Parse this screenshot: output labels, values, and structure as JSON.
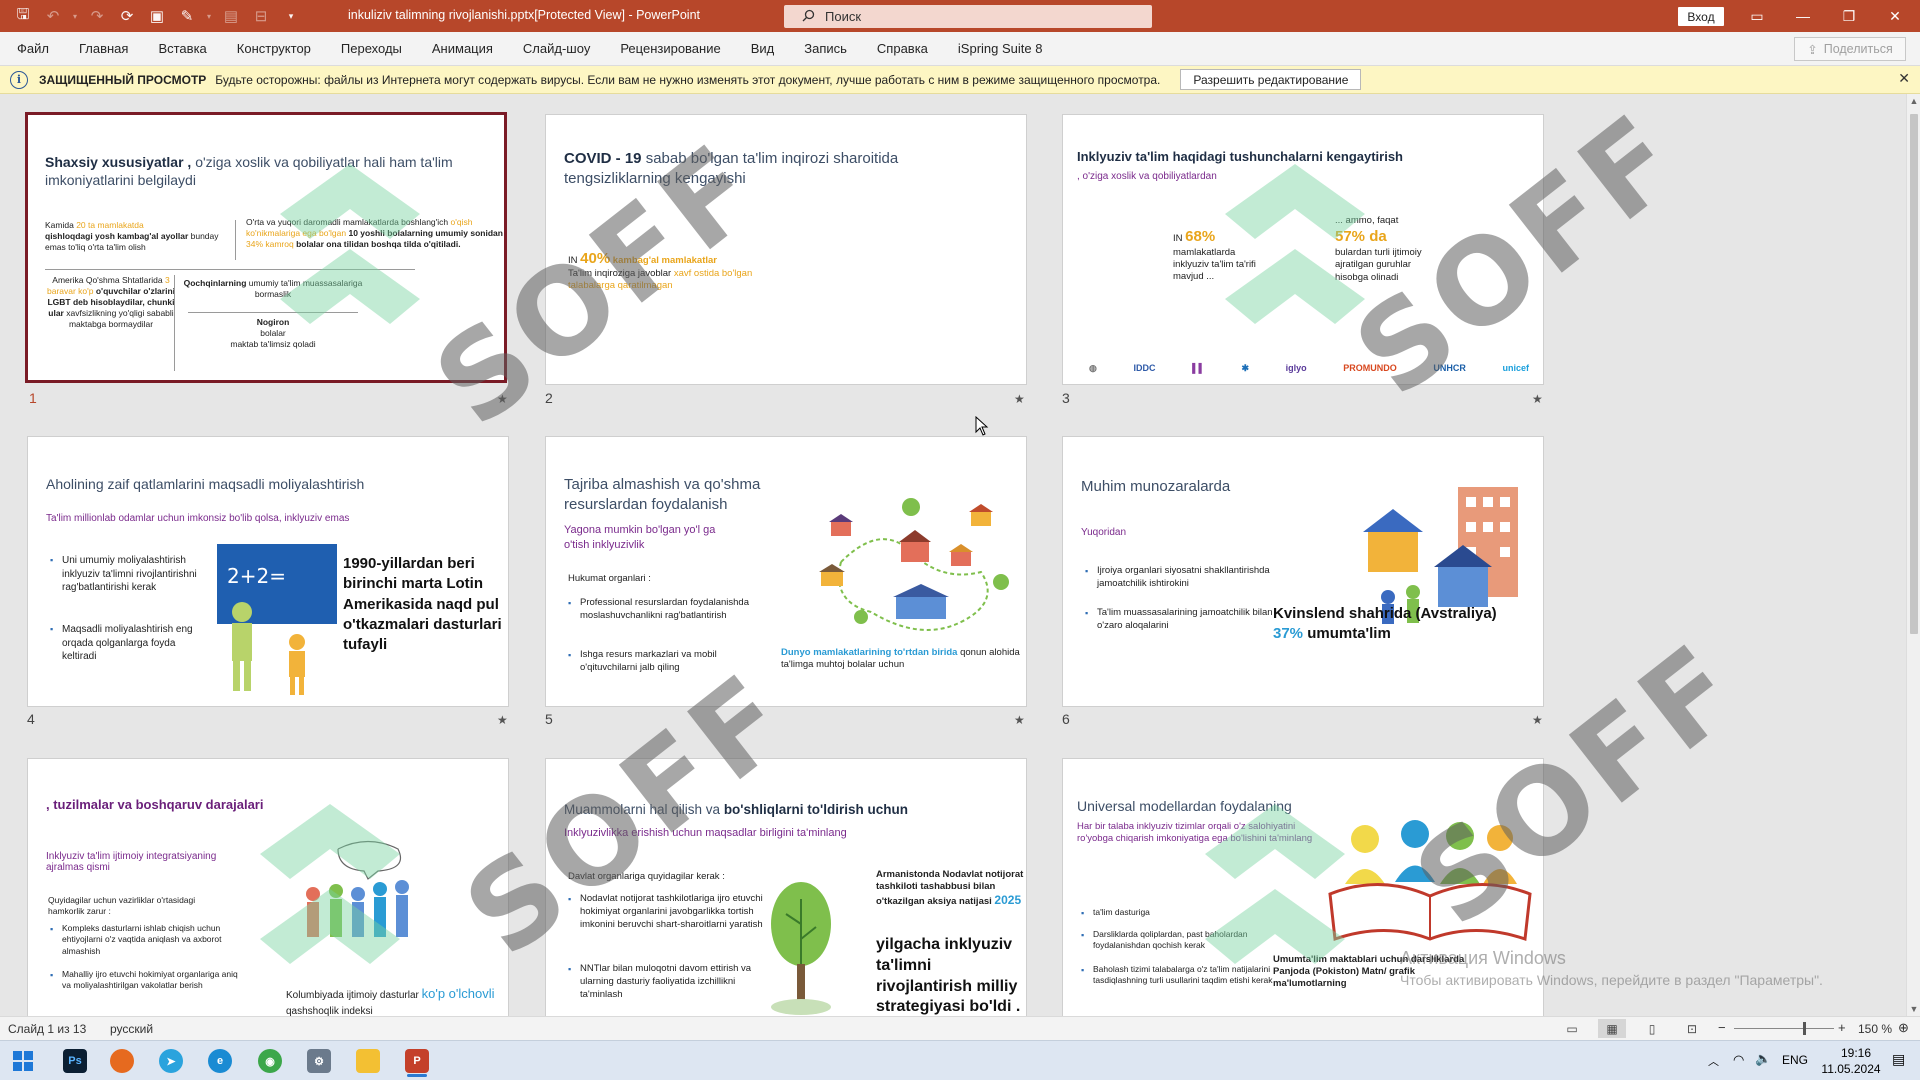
{
  "titlebar": {
    "doc_title": "inkuliziv talimning rivojlanishi.pptx[Protected View]  -  PowerPoint",
    "search_placeholder": "Поиск",
    "login": "Вход"
  },
  "menu": [
    "Файл",
    "Главная",
    "Вставка",
    "Конструктор",
    "Переходы",
    "Анимация",
    "Слайд-шоу",
    "Рецензирование",
    "Вид",
    "Запись",
    "Справка",
    "iSpring Suite 8"
  ],
  "share_label": "Поделиться",
  "protected": {
    "label": "ЗАЩИЩЕННЫЙ ПРОСМОТР",
    "message": "Будьте осторожны: файлы из Интернета могут содержать вирусы. Если вам не нужно изменять этот документ, лучше работать с ним в режиме защищенного просмотра.",
    "enable_button": "Разрешить редактирование"
  },
  "slide_numbers": [
    "1",
    "2",
    "3",
    "4",
    "5",
    "6",
    "7",
    "8",
    "9"
  ],
  "slides": {
    "s1": {
      "title_bold": "Shaxsiy xususiyatlar ,",
      "title_rest": " o'ziga xoslik va qobiliyatlar hali ham ta'lim imkoniyatlarini belgilaydi",
      "c1_a": "Kamida ",
      "c1_b": "20 ta mamlakatda",
      "c1_c": "qishloqdagi yosh kambag'al ayollar",
      "c1_d": " bunday emas to'liq o'rta ta'lim olish",
      "c2_a": "O'rta va yuqori daromadli mamlakatlarda boshlang'ich ",
      "c2_b": "o'qish ko'nikmalariga ega bo'lgan",
      "c2_c": " 10 yoshli bolalarning umumiy sonidan ",
      "c2_d": "34% kamroq",
      "c2_e": " bolalar ona tilidan boshqa tilda o'qitiladi.",
      "c3_a": "Amerika Qo'shma Shtatlarida ",
      "c3_b": "3 baravar ko'p",
      "c3_c": " o'quvchilar o'zlarini LGBT deb hisoblaydilar, chunki ular",
      "c3_d": " xavfsizlikning yo'qligi sababli maktabga bormaydilar",
      "c4_a": "Qochqinlarning",
      "c4_b": " umumiy ta'lim muassasalariga bormaslik",
      "c5_a": "Nogiron",
      "c5_b": "bolalar",
      "c5_c": "maktab ta'limsiz qoladi"
    },
    "s2": {
      "title_bold": "COVID - 19",
      "title_rest": " sabab bo'lgan ta'lim inqirozi sharoitida tengsizliklarning kengayishi",
      "line1_a": "IN ",
      "line1_b": "40%",
      "line1_c": " kambag'al mamlakatlar",
      "line2_a": "Ta'lim inqiroziga javoblar ",
      "line2_b": "xavf ostida bo'lgan talabalarga qaratilmagan"
    },
    "s3": {
      "title": "Inklyuziv ta'lim haqidagi tushunchalarni kengaytirish",
      "subtitle": ", o'ziga xoslik va qobiliyatlardan",
      "left_a": "IN ",
      "left_b": "68%",
      "left_c": "mamlakatlarda inklyuziv ta'lim ta'rifi mavjud ...",
      "right_a": "... ammo, faqat",
      "right_b": "57% da",
      "right_c": "bulardan turli ijtimoiy ajratilgan guruhlar hisobga olinadi",
      "logos": [
        "IDDC",
        "iglyo",
        "PROMUNDO",
        "UNHCR",
        "unicef"
      ]
    },
    "s4": {
      "title": "Aholining zaif qatlamlarini maqsadli moliyalashtirish",
      "subtitle": "Ta'lim millionlab odamlar uchun imkonsiz bo'lib qolsa, inklyuziv emas",
      "bullet1": "Uni umumiy moliyalashtirish inklyuziv ta'limni rivojlantirishni rag'batlantirishi kerak",
      "bullet2": "Maqsadli moliyalashtirish eng orqada qolganlarga foyda keltiradi",
      "board": "2+2=",
      "big": "1990-yillardan beri birinchi marta Lotin Amerikasida naqd pul o'tkazmalari dasturlari tufayli"
    },
    "s5": {
      "title": "Tajriba almashish va qo'shma resurslardan foydalanish",
      "subtitle": "Yagona mumkin bo'lgan yo'l ga o'tish inklyuzivlik",
      "heading": "Hukumat organlari :",
      "bullet1": "Professional resurslardan foydalanishda moslashuvchanlikni rag'batlantirish",
      "bullet2": "Ishga resurs markazlari va mobil o'qituvchilarni jalb qiling",
      "note_a": "Dunyo mamlakatlarining to'rtdan birida",
      "note_b": " qonun alohida ta'limga muhtoj bolalar uchun"
    },
    "s6": {
      "title": "Muhim munozaralarda",
      "subtitle": "Yuqoridan",
      "bullet1": "Ijroiya organlari siyosatni shakllantirishda jamoatchilik ishtirokini",
      "bullet2": "Ta'lim muassasalarining jamoatchilik bilan o'zaro aloqalarini",
      "big_a": "Kvinslend shahrida (Avstraliya)",
      "big_b": "37%",
      "big_c": " umumta'lim"
    },
    "s7": {
      "title": ", tuzilmalar va boshqaruv darajalari",
      "subtitle": "Inklyuziv ta'lim ijtimoiy integratsiyaning ajralmas qismi",
      "heading": "Quyidagilar uchun vazirliklar o'rtasidagi hamkorlik zarur :",
      "bullet1": "Kompleks dasturlarni ishlab chiqish uchun ehtiyojlarni o'z vaqtida aniqlash va axborot almashish",
      "bullet2": "Mahalliy ijro etuvchi hokimiyat organlariga aniq va moliyalashtirilgan vakolatlar berish",
      "note_a": "Kolumbiyada ijtimoiy dasturlar ",
      "note_b": "ko'p o'lchovli",
      "note_c": " qashshoqlik indeksi"
    },
    "s8": {
      "title_a": "Muammolarni hal qilish va ",
      "title_b": "bo'shliqlarni to'ldirish uchun",
      "subtitle": "Inklyuzivlikka erishish uchun maqsadlar birligini ta'minlang",
      "heading": "Davlat organlariga quyidagilar kerak :",
      "bullet1": "Nodavlat notijorat tashkilotlariga ijro etuvchi hokimiyat organlarini javobgarlikka tortish imkonini beruvchi shart-sharoitlarni yaratish",
      "bullet2": "NNTlar bilan muloqotni davom ettirish va ularning dasturiy faoliyatida izchillikni ta'minlash",
      "side_a": "Armanistonda Nodavlat notijorat tashkiloti tashabbusi bilan o'tkazilgan aksiya natijasi ",
      "side_b": "2025",
      "big": "yilgacha inklyuziv ta'limni rivojlantirish milliy strategiyasi bo'ldi ."
    },
    "s9": {
      "title": "Universal modellardan foydalaning",
      "subtitle": "Har bir talaba inklyuziv tizimlar orqali o'z salohiyatini ro'yobga chiqarish imkoniyatiga ega bo'lishini ta'minlang",
      "bullet1": "ta'lim dasturiga",
      "bullet2": "Darsliklarda qoliplardan, past baholardan foydalanishdan qochish kerak",
      "bullet3": "Baholash tizimi talabalarga o'z ta'lim natijalarini tasdiqlashning turli usullarini taqdim etishi kerak",
      "note": "Umumta'lim maktablari uchun darsliklarda Panjoda (Pokiston) Matn/ grafik ma'lumotlarning"
    }
  },
  "watermark": "SOFF",
  "activation": {
    "line1": "Активация Windows",
    "line2": "Чтобы активировать Windows, перейдите в раздел \"Параметры\"."
  },
  "status": {
    "slide": "Слайд 1 из 13",
    "language": "русский",
    "zoom": "150 %"
  },
  "taskbar": {
    "lang": "ENG",
    "time": "19:16",
    "date": "11.05.2024"
  }
}
